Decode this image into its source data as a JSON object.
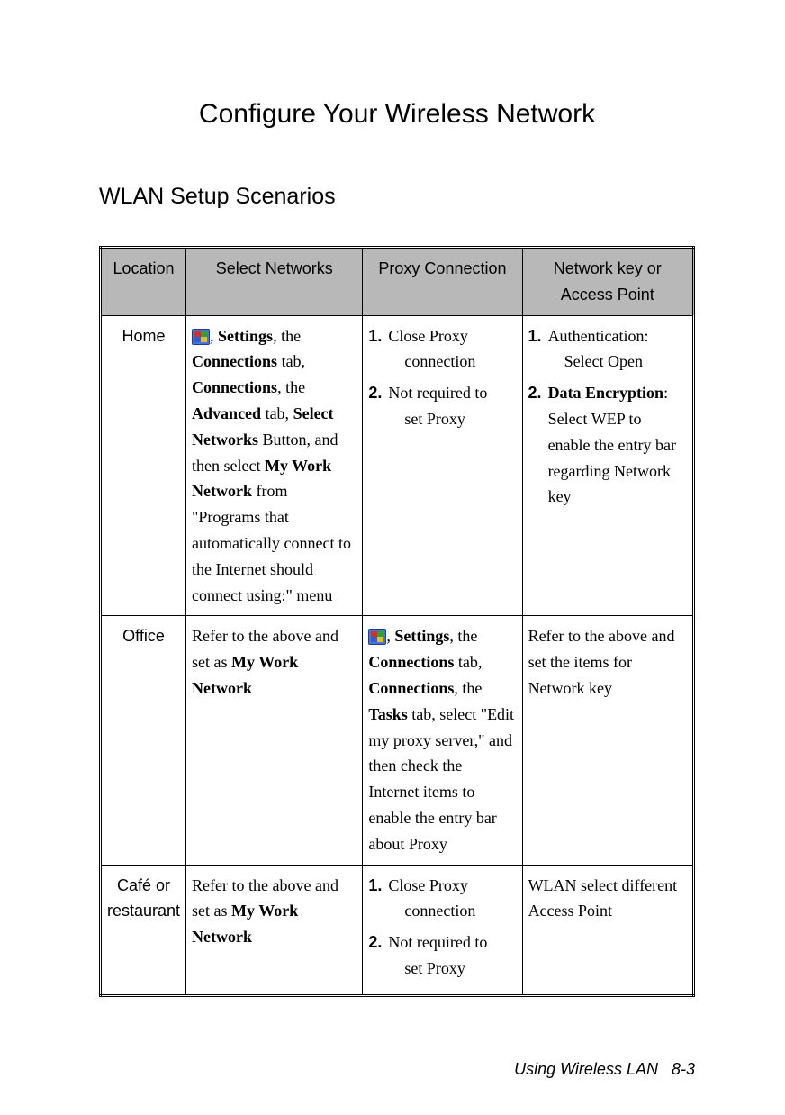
{
  "title": "Configure Your Wireless Network",
  "section": "WLAN Setup Scenarios",
  "headers": {
    "location": "Location",
    "select_networks": "Select Networks",
    "proxy": "Proxy Connection",
    "key": "Network key or Access Point"
  },
  "rows": {
    "home": {
      "location": "Home",
      "select_prefix": ", ",
      "select_b1": "Settings",
      "select_t1": ", the ",
      "select_b2": "Connections",
      "select_t2": " tab, ",
      "select_b3": "Connections",
      "select_t3": ", the ",
      "select_b4": "Advanced",
      "select_t4": " tab, ",
      "select_b5": "Select Networks",
      "select_t5": " Button, and then select ",
      "select_b6": "My Work Network",
      "select_t6": " from \"Programs that automatically connect to the Internet should connect using:\" menu",
      "proxy_1a": "Close Proxy",
      "proxy_1b": "connection",
      "proxy_2a": "Not required to",
      "proxy_2b": "set Proxy",
      "key_1a": "Authentication:",
      "key_1b": "Select Open",
      "key_2b": "Data Encryption",
      "key_2t": ": Select WEP to enable the entry bar regarding Network key"
    },
    "office": {
      "location": "Office",
      "select_t1": "Refer to the above and set as ",
      "select_b1": "My Work Network",
      "proxy_prefix": ", ",
      "proxy_b1": "Settings",
      "proxy_t1": ", the ",
      "proxy_b2": "Connections",
      "proxy_t2": " tab, ",
      "proxy_b3": "Connections",
      "proxy_t3": ", the ",
      "proxy_b4": "Tasks",
      "proxy_t4": " tab, select \"Edit my proxy server,\" and then check the Internet items to enable the entry bar about Proxy",
      "key": "Refer to the above and set the items for Network key"
    },
    "cafe": {
      "location": "Café or restaurant",
      "select_t1": "Refer to the above and set as ",
      "select_b1": "My Work Network",
      "proxy_1a": "Close Proxy",
      "proxy_1b": "connection",
      "proxy_2a": "Not required to",
      "proxy_2b": "set Proxy",
      "key": "WLAN select different Access Point"
    }
  },
  "footer_text": "Using Wireless LAN",
  "footer_page": "8-3"
}
